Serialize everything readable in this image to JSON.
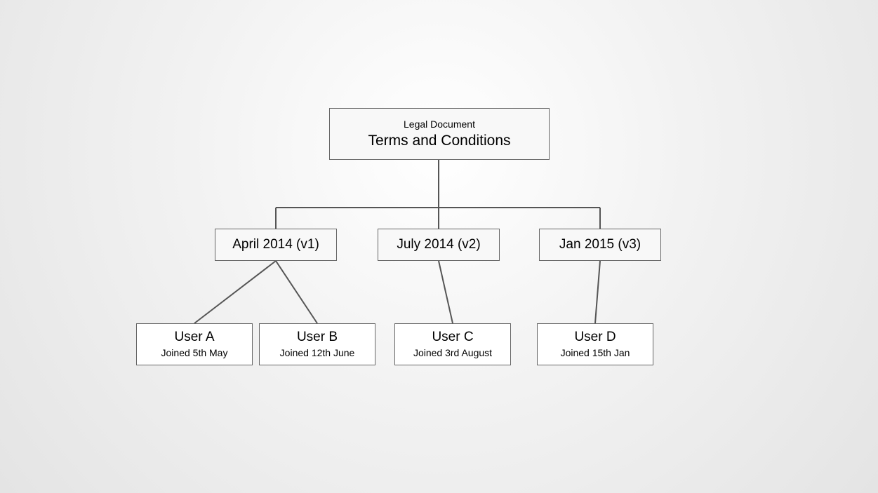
{
  "root": {
    "subtitle": "Legal Document",
    "title": "Terms and Conditions"
  },
  "versions": {
    "v1": {
      "label": "April 2014 (v1)"
    },
    "v2": {
      "label": "July 2014 (v2)"
    },
    "v3": {
      "label": "Jan 2015 (v3)"
    }
  },
  "users": {
    "a": {
      "name": "User A",
      "joined": "Joined 5th May"
    },
    "b": {
      "name": "User B",
      "joined": "Joined 12th June"
    },
    "c": {
      "name": "User C",
      "joined": "Joined 3rd August"
    },
    "d": {
      "name": "User D",
      "joined": "Joined 15th Jan"
    }
  }
}
